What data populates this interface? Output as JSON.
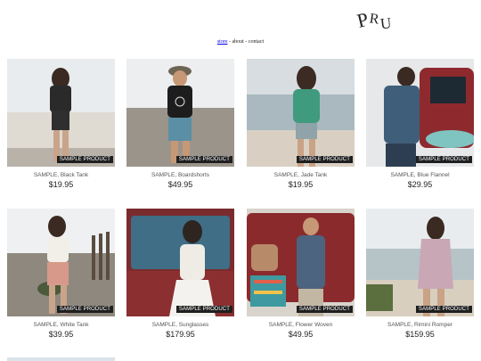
{
  "brand": {
    "logo_text": "PRU"
  },
  "nav": {
    "store": "store",
    "sep1": " - ",
    "about": "about",
    "sep2": " - ",
    "contact": "contact"
  },
  "badge_label": "SAMPLE PRODUCT",
  "products": [
    {
      "name": "SAMPLE, Black Tank",
      "price": "$19.95"
    },
    {
      "name": "SAMPLE, Boardshorts",
      "price": "$49.95"
    },
    {
      "name": "SAMPLE, Jade Tank",
      "price": "$19.95"
    },
    {
      "name": "SAMPLE, Blue Flannel",
      "price": "$29.95"
    },
    {
      "name": "SAMPLE, White Tank",
      "price": "$39.95"
    },
    {
      "name": "SAMPLE, Sunglasses",
      "price": "$179.95"
    },
    {
      "name": "SAMPLE, Flower Woven",
      "price": "$49.95"
    },
    {
      "name": "SAMPLE, Rimini Romper",
      "price": "$159.95"
    }
  ]
}
